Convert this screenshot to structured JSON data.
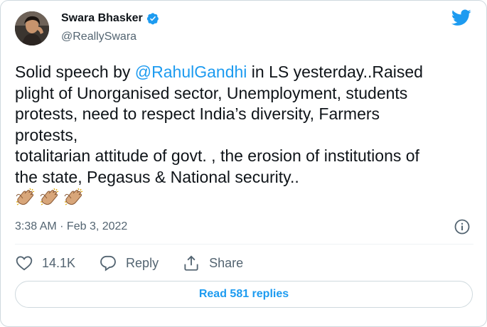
{
  "author": {
    "display_name": "Swara Bhasker",
    "handle": "@ReallySwara",
    "verified": true
  },
  "tweet": {
    "lines": [
      {
        "pre": "Solid speech by ",
        "mention": "@RahulGandhi",
        "post": " in LS yesterday..Raised"
      },
      {
        "text": "plight of Unorganised sector, Unemployment, students"
      },
      {
        "text": "protests, need to respect India’s diversity, Farmers"
      },
      {
        "text": "protests,"
      },
      {
        "text": "totalitarian attitude of govt. , the erosion of institutions of"
      },
      {
        "text": "the state, Pegasus & National security.."
      }
    ],
    "emoji": [
      "👏🏽",
      "👏🏽",
      "👏🏽"
    ],
    "timestamp": "3:38 AM · Feb 3, 2022"
  },
  "actions": {
    "likes_count": "14.1K",
    "reply_label": "Reply",
    "share_label": "Share"
  },
  "read_replies_label": "Read 581 replies",
  "icons": {
    "brand": "twitter-bird-icon",
    "verified": "verified-badge-icon",
    "info": "info-icon",
    "like": "heart-icon",
    "reply": "reply-bubble-icon",
    "share": "share-icon",
    "clap": "clapping-hands-icon"
  },
  "colors": {
    "brand_blue": "#1d9bf0",
    "text_primary": "#0f1419",
    "text_secondary": "#536471",
    "border": "#cfd9de",
    "clap_skin": "#d8a67a"
  }
}
